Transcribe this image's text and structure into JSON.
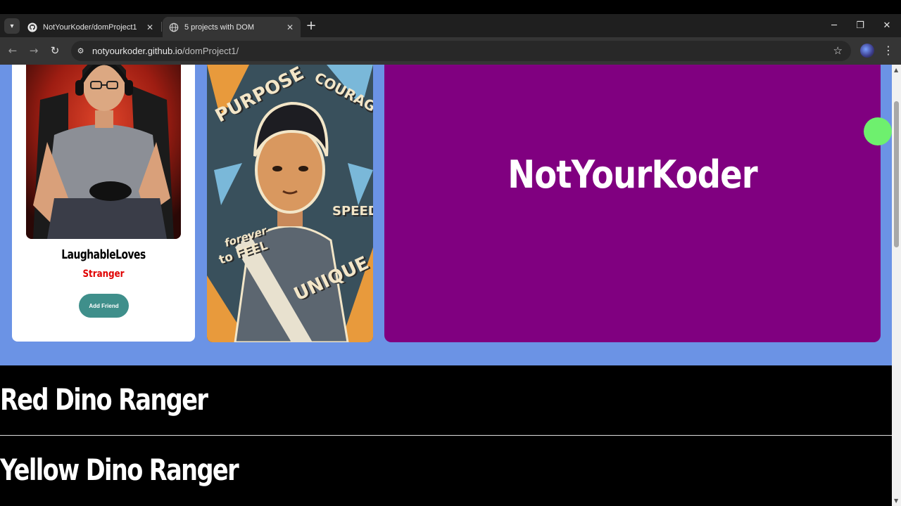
{
  "browser": {
    "tabs": [
      {
        "title": "NotYourKoder/domProject1",
        "icon": "github-icon",
        "active": false
      },
      {
        "title": "5 projects with DOM",
        "icon": "globe-icon",
        "active": true
      }
    ],
    "url_host": "notyourkoder.github.io",
    "url_path": "/domProject1/"
  },
  "page": {
    "profile_card": {
      "name": "LaughableLoves",
      "status": "Stranger",
      "button_label": "Add Friend"
    },
    "poster": {
      "words": [
        "PURPOSE",
        "COURAGE",
        "SPEED",
        "forever",
        "to FEEL",
        "UNIQUE"
      ]
    },
    "brand_panel": {
      "title": "NotYourKoder"
    },
    "rangers": [
      "Red Dino Ranger",
      "Yellow Dino Ranger"
    ]
  },
  "colors": {
    "hero_bg": "#6b93e5",
    "brand_panel": "#800080",
    "add_friend_button": "#3f8f8b",
    "status_text": "#e00000",
    "ball": "#6ef06e"
  }
}
